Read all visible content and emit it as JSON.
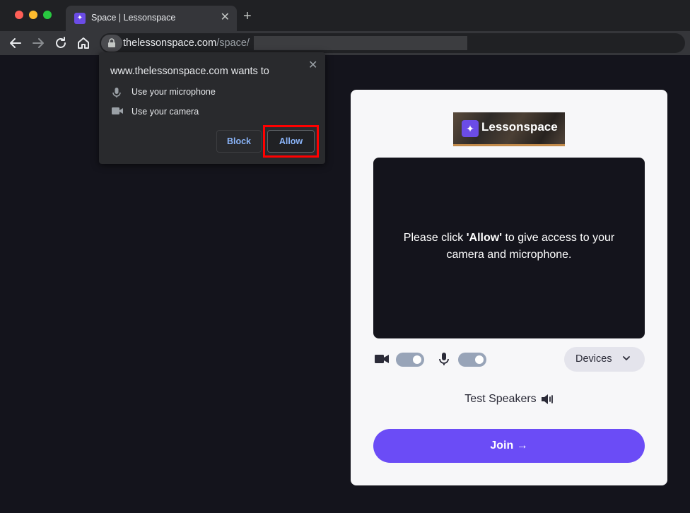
{
  "browser": {
    "tab_title": "Space | Lessonspace",
    "tab_close": "✕",
    "new_tab": "+",
    "url_host": "thelessonspace.com",
    "url_path": "/space/"
  },
  "permission": {
    "title": "www.thelessonspace.com wants to",
    "close": "✕",
    "items": [
      {
        "icon": "microphone-icon",
        "label": "Use your microphone"
      },
      {
        "icon": "camera-icon",
        "label": "Use your camera"
      }
    ],
    "block_label": "Block",
    "allow_label": "Allow"
  },
  "card": {
    "logo_mark": "✦",
    "logo_text": "Lessonspace",
    "message_pre": "Please click ",
    "message_bold": "'Allow'",
    "message_post": " to give access to your camera and microphone.",
    "devices_label": "Devices",
    "speakers_label": "Test Speakers",
    "join_label": "Join →"
  },
  "toggles": {
    "camera_on": true,
    "microphone_on": true
  },
  "colors": {
    "accent": "#6b4cf6",
    "background": "#14141c",
    "highlight": "#ff0000",
    "link_blue": "#8ab4f8"
  }
}
